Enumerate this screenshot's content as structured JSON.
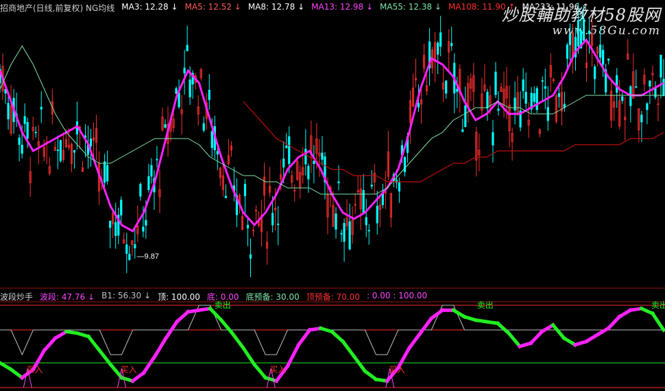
{
  "top_legend": [
    {
      "text": "招商地产(日线,前复权) NG均线",
      "color": "#cfcfcf"
    },
    {
      "text": "MA3: 12.28",
      "arrow": "↓",
      "color": "#ffffff"
    },
    {
      "text": "MA5: 12.52",
      "arrow": "↓",
      "color": "#ff5a5a"
    },
    {
      "text": "MA8: 12.78",
      "arrow": "↓",
      "color": "#ffffff"
    },
    {
      "text": "MA13: 12.98",
      "arrow": "↓",
      "color": "#ff44ff"
    },
    {
      "text": "MA55: 12.38",
      "arrow": "↓",
      "color": "#7fe5a8"
    },
    {
      "text": "MA108: 11.90",
      "arrow": "↑",
      "color": "#ff3030"
    },
    {
      "text": "MA233: 11.96",
      "arrow": "↑",
      "color": "#ffffff"
    }
  ],
  "bottom_legend": [
    {
      "text": "波段炒手",
      "color": "#cfcfcf"
    },
    {
      "text": "波段: 47.76",
      "arrow": "↓",
      "color": "#ff44ff"
    },
    {
      "text": "B1: 56.30",
      "arrow": "↓",
      "color": "#c0c0c0"
    },
    {
      "text": "顶: 100.00",
      "color": "#ffffff"
    },
    {
      "text": "底: 0.00",
      "color": "#ff44ff"
    },
    {
      "text": "底预备: 30.00",
      "color": "#7fe5a8"
    },
    {
      "text": "顶预备: 70.00",
      "color": "#ff3030"
    },
    {
      "text": ": 0.00 : 100.00",
      "color": "#ff44ff"
    }
  ],
  "watermark": {
    "line1": "炒股輔助教材58股网",
    "line2": "www.58Gu.com"
  },
  "colors": {
    "up": "#ff3030",
    "down": "#00ffff",
    "ma13": "#ff22ff",
    "ma55": "#7fe5a8",
    "ma108": "#c01010",
    "ma233": "#ffffff",
    "osc_up": "#ff22ff",
    "osc_down": "#22ee22",
    "level_red": "#ff3030",
    "level_green": "#22ee22"
  },
  "chart_data": [
    {
      "type": "line",
      "panel": "price",
      "title": "",
      "min_label": "9.87",
      "ylim": [
        9.6,
        13.6
      ],
      "x": [
        0,
        4,
        8,
        12,
        16,
        20,
        24,
        28,
        32,
        36,
        40,
        44,
        48,
        52,
        56,
        60,
        64,
        68,
        72,
        76,
        80,
        84,
        88,
        92,
        96,
        100,
        104,
        108,
        112,
        116,
        120,
        124,
        128,
        132,
        136,
        140,
        144,
        148,
        152,
        156,
        160,
        164,
        168,
        172,
        176,
        180,
        184,
        188,
        192,
        196,
        200,
        204,
        208,
        212,
        216,
        220,
        224,
        228,
        232,
        236,
        240
      ],
      "series": [
        {
          "name": "MA13",
          "values": [
            12.9,
            12.4,
            11.9,
            11.6,
            11.7,
            11.8,
            11.9,
            12.0,
            11.7,
            11.2,
            10.7,
            10.4,
            10.3,
            10.6,
            11.1,
            11.8,
            12.5,
            12.9,
            12.7,
            12.1,
            11.5,
            11.0,
            10.6,
            10.4,
            10.6,
            10.9,
            11.3,
            11.5,
            11.6,
            11.3,
            10.9,
            10.6,
            10.5,
            10.6,
            10.8,
            11.0,
            11.3,
            11.9,
            12.6,
            13.1,
            13.0,
            12.8,
            12.4,
            12.1,
            12.2,
            12.4,
            12.2,
            12.2,
            12.3,
            12.4,
            12.5,
            12.8,
            13.2,
            13.4,
            13.1,
            12.8,
            12.6,
            12.5,
            12.5,
            12.6,
            12.7
          ]
        },
        {
          "name": "MA55",
          "values": [
            12.6,
            13.0,
            13.3,
            13.0,
            12.6,
            12.2,
            11.9,
            11.7,
            11.5,
            11.4,
            11.4,
            11.5,
            11.6,
            11.7,
            11.8,
            11.8,
            11.8,
            11.8,
            11.7,
            11.5,
            11.4,
            11.3,
            11.2,
            11.2,
            11.1,
            11.1,
            11.0,
            11.0,
            11.0,
            10.9,
            10.9,
            10.9,
            10.9,
            10.9,
            10.9,
            11.0,
            11.2,
            11.4,
            11.6,
            11.8,
            11.9,
            12.1,
            12.2,
            12.3,
            12.3,
            12.4,
            12.3,
            12.3,
            12.2,
            12.2,
            12.2,
            12.3,
            12.4,
            12.5,
            12.5,
            12.5,
            12.5,
            12.5,
            12.5,
            12.5,
            12.5
          ]
        },
        {
          "name": "MA108",
          "values": [
            null,
            null,
            null,
            null,
            null,
            null,
            null,
            null,
            null,
            null,
            null,
            null,
            null,
            null,
            null,
            null,
            null,
            null,
            null,
            null,
            null,
            null,
            12.4,
            12.2,
            12.0,
            11.8,
            11.7,
            11.6,
            11.5,
            11.4,
            11.3,
            11.3,
            11.2,
            11.2,
            11.2,
            11.1,
            11.1,
            11.1,
            11.1,
            11.2,
            11.3,
            11.4,
            11.4,
            11.5,
            11.5,
            11.6,
            11.6,
            11.6,
            11.6,
            11.6,
            11.6,
            11.6,
            11.7,
            11.7,
            11.7,
            11.7,
            11.7,
            11.8,
            11.8,
            11.8,
            11.9
          ]
        }
      ]
    },
    {
      "type": "line",
      "panel": "oscillator",
      "ylim": [
        0,
        100
      ],
      "levels": [
        0,
        30,
        70,
        100
      ],
      "annotations": [
        {
          "text": "卖出",
          "x": 78,
          "y": 95
        },
        {
          "text": "买入",
          "x": 10,
          "y": 8
        },
        {
          "text": "买入",
          "x": 44,
          "y": 8
        },
        {
          "text": "买入",
          "x": 98,
          "y": 8
        },
        {
          "text": "买入",
          "x": 141,
          "y": 8
        },
        {
          "text": "卖出",
          "x": 173,
          "y": 95
        },
        {
          "text": "卖出",
          "x": 236,
          "y": 95
        }
      ],
      "x": [
        0,
        4,
        8,
        12,
        16,
        20,
        24,
        28,
        32,
        36,
        40,
        44,
        48,
        52,
        56,
        60,
        64,
        68,
        72,
        76,
        80,
        84,
        88,
        92,
        96,
        100,
        104,
        108,
        112,
        116,
        120,
        124,
        128,
        132,
        136,
        140,
        144,
        148,
        152,
        156,
        160,
        164,
        168,
        172,
        176,
        180,
        184,
        188,
        192,
        196,
        200,
        204,
        208,
        212,
        216,
        220,
        224,
        228,
        232,
        236,
        240
      ],
      "series": [
        {
          "name": "波段",
          "values": [
            30,
            22,
            12,
            22,
            45,
            60,
            68,
            66,
            62,
            45,
            28,
            12,
            8,
            18,
            38,
            60,
            80,
            92,
            94,
            96,
            82,
            66,
            48,
            28,
            12,
            8,
            26,
            52,
            70,
            72,
            68,
            56,
            38,
            20,
            10,
            8,
            24,
            48,
            66,
            84,
            94,
            94,
            86,
            82,
            80,
            78,
            66,
            50,
            54,
            68,
            76,
            60,
            52,
            56,
            64,
            72,
            86,
            94,
            96,
            90,
            70
          ]
        },
        {
          "name": "B1",
          "values": [
            70,
            70,
            40,
            70,
            70,
            70,
            70,
            70,
            70,
            70,
            40,
            40,
            70,
            70,
            70,
            70,
            70,
            70,
            100,
            100,
            70,
            70,
            70,
            70,
            40,
            40,
            70,
            70,
            70,
            70,
            70,
            70,
            70,
            70,
            40,
            40,
            70,
            70,
            70,
            70,
            100,
            100,
            70,
            70,
            70,
            70,
            70,
            70,
            70,
            70,
            70,
            70,
            70,
            70,
            70,
            70,
            70,
            70,
            70,
            70,
            70
          ]
        }
      ]
    }
  ]
}
